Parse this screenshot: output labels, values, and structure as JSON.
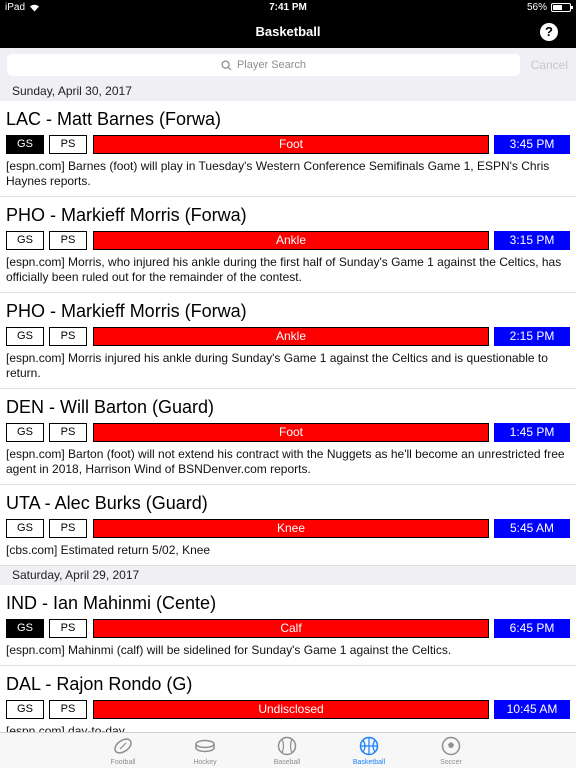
{
  "status": {
    "device": "iPad",
    "time": "7:41 PM",
    "battery": "56%",
    "battery_level": 0.56
  },
  "nav": {
    "title": "Basketball",
    "help": "?"
  },
  "search": {
    "placeholder": "Player Search",
    "cancel": "Cancel"
  },
  "sections": [
    {
      "header": "Sunday, April 30, 2017",
      "items": [
        {
          "title": "LAC - Matt Barnes (Forwa)",
          "gs": "GS",
          "ps": "PS",
          "gs_active": true,
          "ps_active": false,
          "injury": "Foot",
          "time": "3:45 PM",
          "desc": "[espn.com] Barnes (foot) will play in Tuesday's Western Conference Semifinals Game 1, ESPN's Chris Haynes reports."
        },
        {
          "title": "PHO - Markieff Morris (Forwa)",
          "gs": "GS",
          "ps": "PS",
          "gs_active": false,
          "ps_active": false,
          "injury": "Ankle",
          "time": "3:15 PM",
          "desc": "[espn.com] Morris, who injured his ankle during the first half of Sunday's Game 1 against the Celtics, has officially been ruled out for the remainder of the contest."
        },
        {
          "title": "PHO - Markieff Morris (Forwa)",
          "gs": "GS",
          "ps": "PS",
          "gs_active": false,
          "ps_active": false,
          "injury": "Ankle",
          "time": "2:15 PM",
          "desc": "[espn.com] Morris injured his ankle during Sunday's Game 1 against the Celtics and is questionable to return."
        },
        {
          "title": "DEN - Will Barton (Guard)",
          "gs": "GS",
          "ps": "PS",
          "gs_active": false,
          "ps_active": false,
          "injury": "Foot",
          "time": "1:45 PM",
          "desc": "[espn.com] Barton (foot) will not extend his contract with the Nuggets as he'll become an unrestricted free agent in 2018, Harrison Wind of BSNDenver.com reports."
        },
        {
          "title": "UTA - Alec Burks (Guard)",
          "gs": "GS",
          "ps": "PS",
          "gs_active": false,
          "ps_active": false,
          "injury": "Knee",
          "time": "5:45 AM",
          "desc": "[cbs.com] Estimated return 5/02, Knee"
        }
      ]
    },
    {
      "header": "Saturday, April 29, 2017",
      "items": [
        {
          "title": "IND - Ian Mahinmi (Cente)",
          "gs": "GS",
          "ps": "PS",
          "gs_active": true,
          "ps_active": false,
          "injury": "Calf",
          "time": "6:45 PM",
          "desc": "[espn.com] Mahinmi (calf) will be sidelined for Sunday's Game 1 against the Celtics."
        },
        {
          "title": "DAL - Rajon Rondo (G)",
          "gs": "GS",
          "ps": "PS",
          "gs_active": false,
          "ps_active": false,
          "injury": "Undisclosed",
          "time": "10:45 AM",
          "desc": "[espn.com] day-to-day"
        }
      ]
    }
  ],
  "tabs": [
    {
      "label": "Football",
      "icon": "football-icon",
      "active": false
    },
    {
      "label": "Hockey",
      "icon": "hockey-puck-icon",
      "active": false
    },
    {
      "label": "Baseball",
      "icon": "baseball-icon",
      "active": false
    },
    {
      "label": "Basketball",
      "icon": "basketball-icon",
      "active": true
    },
    {
      "label": "Soccer",
      "icon": "soccer-ball-icon",
      "active": false
    }
  ],
  "colors": {
    "injury": "#ff0000",
    "time": "#0000ff",
    "active_tab": "#1a82fb"
  }
}
